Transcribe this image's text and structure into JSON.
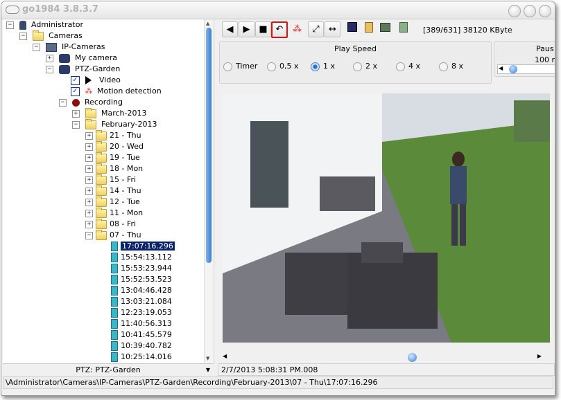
{
  "window": {
    "title": "go1984 3.8.3.7"
  },
  "tree": {
    "administrator": "Administrator",
    "cameras": "Cameras",
    "ip_cameras": "IP-Cameras",
    "my_camera": "My camera",
    "ptz_garden": "PTZ-Garden",
    "video": "Video",
    "motion_detection": "Motion detection",
    "recording": "Recording",
    "march": "March-2013",
    "february": "February-2013",
    "days": [
      "21 - Thu",
      "20 - Wed",
      "19 - Tue",
      "18 - Mon",
      "15 - Fri",
      "14 - Thu",
      "12 - Tue",
      "11 - Mon",
      "08 - Fri",
      "07 - Thu"
    ],
    "times": [
      "17:07:16.296",
      "15:54:13.112",
      "15:53:23.944",
      "15:52:53.523",
      "13:04:46.428",
      "13:03:21.084",
      "12:23:19.053",
      "11:40:56.313",
      "10:41:45.579",
      "10:39:40.782",
      "10:25:14.016"
    ]
  },
  "pane_footer": "PTZ: PTZ-Garden",
  "toolbar": {
    "status": "[389/631] 38120 KByte",
    "buttons": [
      "rewind-icon",
      "play-icon",
      "stop-icon",
      "repeat-icon",
      "motion-icon",
      "fullscreen-icon",
      "fit-width-icon",
      "save-icon",
      "clipboard-icon",
      "export-icon",
      "trash-icon"
    ]
  },
  "play_speed": {
    "title": "Play Speed",
    "options": [
      "Timer",
      "0,5 x",
      "1 x",
      "2 x",
      "4 x",
      "8 x"
    ],
    "selected": "1 x"
  },
  "pause": {
    "title": "Paus",
    "value": "100 r"
  },
  "status_bar": "2/7/2013 5:08:31 PM.008",
  "path_bar": "\\Administrator\\Cameras\\IP-Cameras\\PTZ-Garden\\Recording\\February-2013\\07 - Thu\\17:07:16.296",
  "colors": {
    "selection": "#0a246a",
    "active_button_border": "#e01010",
    "scroll_thumb": "#3b7fcc"
  }
}
